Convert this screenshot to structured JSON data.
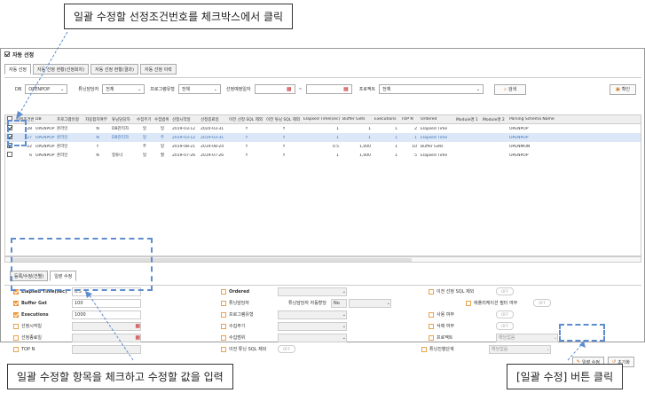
{
  "callouts": {
    "top": "일괄 수정할 선정조건번호를 체크박스에서 클릭",
    "bottom_left": "일괄 수정할 항목을 체크하고 수정할 값을 입력",
    "bottom_right": "[일괄 수정] 버튼 클릭"
  },
  "window": {
    "title": "자동 선정"
  },
  "tabs": [
    "자동 선정",
    "자동 선정 현황(선정회차)",
    "자동 선정 현황(결과)",
    "자동 선정 이력"
  ],
  "filter": {
    "db_label": "DB",
    "db_value": "OPENPOP",
    "owner_label": "튜닝담당자",
    "owner_value": "전체",
    "program_label": "프로그램유형",
    "program_value": "전체",
    "date_label": "선정예정일자",
    "project_label": "프로젝트",
    "project_value": "전체",
    "search_label": "검색",
    "add_label": "확인"
  },
  "grid": {
    "headers": [
      "",
      "선정조건번호",
      "DB",
      "프로그램유형",
      "자동합치여부",
      "튜닝담당자",
      "수집주기",
      "수집범위",
      "선정시작일",
      "선정종료일",
      "이전 선정 SQL 제외",
      "이전 튜닝 SQL 제외",
      "Elapsed Time(sec)",
      "Buffer Gets",
      "Executions",
      "TOP N",
      "Ordered",
      "Module명 1",
      "Module명 2",
      "Parsing Schema Name"
    ],
    "rows": [
      {
        "checked": true,
        "cells": [
          "28",
          "OPENPOP",
          "온라인",
          "N",
          "DB관리자",
          "일",
          "일",
          "2019-03-12",
          "2020-03-31",
          "Y",
          "Y",
          "1",
          "1",
          "1",
          "2",
          "Elapsed Time",
          "",
          "",
          "OPENPOP"
        ]
      },
      {
        "checked": true,
        "cells": [
          "27",
          "OPENPOP",
          "온라인",
          "N",
          "DB관리자",
          "일",
          "주",
          "2019-03-12",
          "2019-03-31",
          "Y",
          "Y",
          "1",
          "1",
          "1",
          "1",
          "Elapsed Time",
          "",
          "",
          "OPENPOP"
        ]
      },
      {
        "checked": true,
        "cells": [
          "22",
          "OPENPOP",
          "온라인",
          "Y",
          "",
          "주",
          "일",
          "2019-08-21",
          "2019-08-24",
          "Y",
          "Y",
          "0.5",
          "1,000",
          "1",
          "10",
          "Buffer Gets",
          "",
          "",
          "OPENMON"
        ]
      },
      {
        "checked": false,
        "cells": [
          "6",
          "OPENPOP",
          "온라인",
          "N",
          "정튜너",
          "일",
          "월",
          "2019-07-26",
          "2019-07-26",
          "Y",
          "Y",
          "1",
          "1,000",
          "1",
          "5",
          "Elapsed Time",
          "",
          "",
          "OPENPOP"
        ]
      }
    ]
  },
  "bottom_tabs": [
    "등록/수정(건별)",
    "일괄 수정"
  ],
  "form": {
    "col1": [
      {
        "label": "Elapsed Time(sec)",
        "value": "0.5",
        "checked": true,
        "bold": true
      },
      {
        "label": "Buffer Get",
        "value": "100",
        "checked": true,
        "bold": true
      },
      {
        "label": "Executions",
        "value": "1000",
        "checked": true,
        "bold": true
      },
      {
        "label": "선정시작일",
        "value": "",
        "checked": false,
        "bold": false
      },
      {
        "label": "선정종료일",
        "value": "",
        "checked": false,
        "bold": false
      },
      {
        "label": "TOP N",
        "value": "",
        "checked": false,
        "bold": false
      }
    ],
    "col2": [
      {
        "label": "Ordered"
      },
      {
        "label": "튜닝담당자",
        "extra": "튜닝담당자 자동할당",
        "extra2": "No"
      },
      {
        "label": "프로그램유형"
      },
      {
        "label": "수집주기"
      },
      {
        "label": "수집범위"
      },
      {
        "label": "이전 튜닝 SQL 제외",
        "toggle": "OFF"
      }
    ],
    "col3": [
      {
        "label": "이전 선정 SQL 제외",
        "toggle": "OFF"
      },
      {
        "label": "애플리케이션 필터 여부",
        "toggle": "OFF"
      },
      {
        "label": "사용 여부",
        "toggle": "OFF"
      },
      {
        "label": "삭제 여부",
        "toggle": "OFF"
      },
      {
        "label": "프로젝트",
        "value": "해당없음"
      },
      {
        "label": "튜닝진행단계",
        "value": "해당없음"
      }
    ],
    "bulk_edit_label": "일괄 수정",
    "reset_label": "초기화"
  },
  "colors": {
    "accent": "#5d8ccf",
    "selected_row": "#dce8f7",
    "check_orange": "#f2a23e"
  }
}
